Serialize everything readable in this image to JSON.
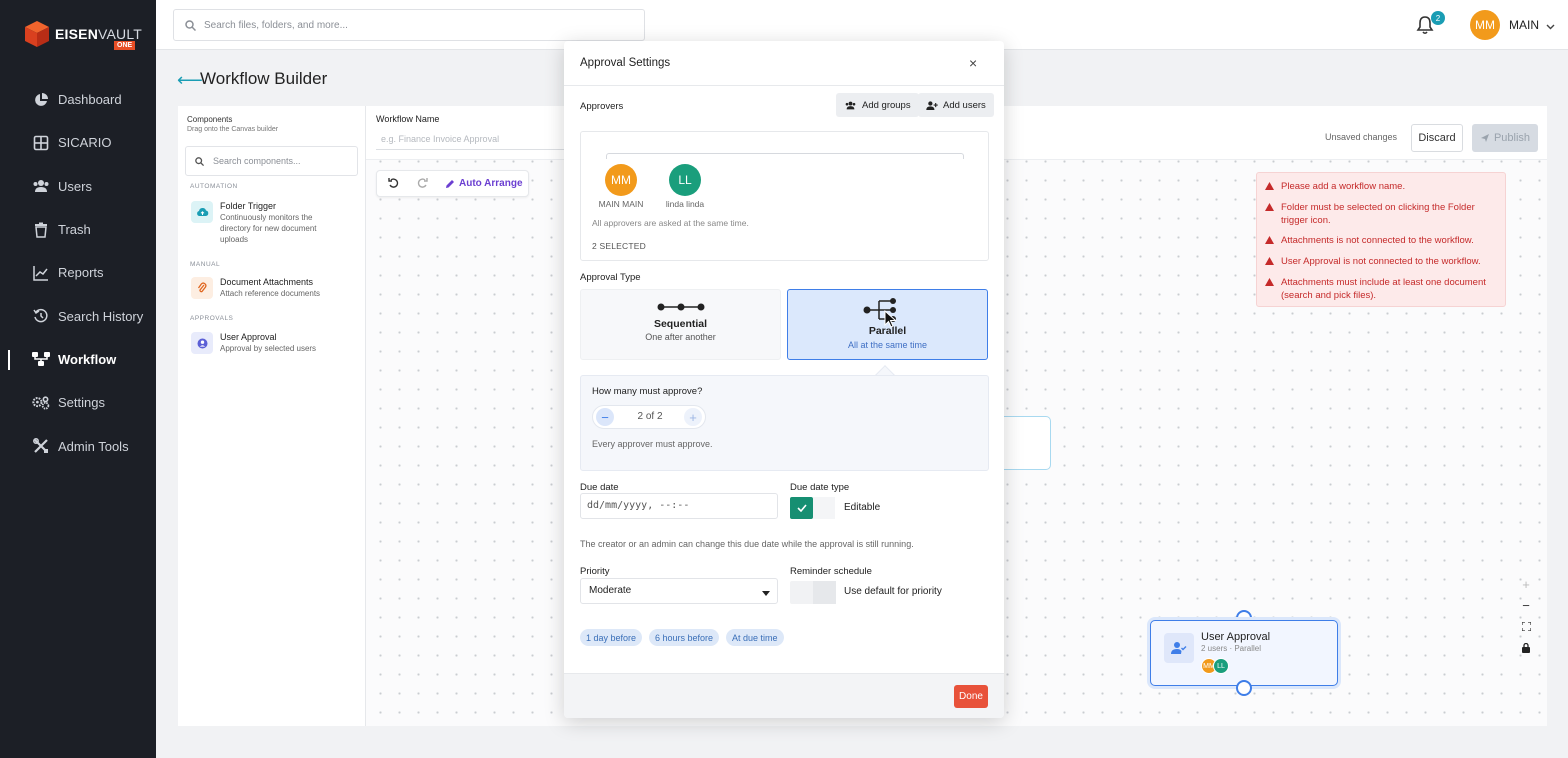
{
  "brand": {
    "name_bold": "EISEN",
    "name_light": "VAULT",
    "badge": "ONE"
  },
  "colors": {
    "accent": "#1a9db4",
    "primary": "#3f7ee8",
    "danger": "#e8523a",
    "success": "#168f72",
    "sidebar_bg": "#1c1f26"
  },
  "sidebar": {
    "items": [
      {
        "label": "Dashboard",
        "icon": "pie-chart-icon"
      },
      {
        "label": "SICARIO",
        "icon": "grid-icon"
      },
      {
        "label": "Users",
        "icon": "users-icon"
      },
      {
        "label": "Trash",
        "icon": "trash-icon"
      },
      {
        "label": "Reports",
        "icon": "line-chart-icon"
      },
      {
        "label": "Search History",
        "icon": "history-icon"
      },
      {
        "label": "Workflow",
        "icon": "workflow-icon",
        "active": true
      },
      {
        "label": "Settings",
        "icon": "gears-icon"
      },
      {
        "label": "Admin Tools",
        "icon": "tools-icon"
      }
    ]
  },
  "topbar": {
    "search_placeholder": "Search files, folders, and more...",
    "notification_count": "2",
    "user_initials": "MM",
    "user_name": "MAIN"
  },
  "page": {
    "title": "Workflow Builder"
  },
  "components_panel": {
    "title": "Components",
    "subtitle": "Drag onto the Canvas builder",
    "search_placeholder": "Search components...",
    "sections": [
      {
        "title": "AUTOMATION",
        "items": [
          {
            "title": "Folder Trigger",
            "desc": "Continuously monitors the directory for new document uploads",
            "icon": "cloud-upload-icon"
          }
        ]
      },
      {
        "title": "MANUAL",
        "items": [
          {
            "title": "Document Attachments",
            "desc": "Attach reference documents",
            "icon": "paperclip-icon"
          }
        ]
      },
      {
        "title": "APPROVALS",
        "items": [
          {
            "title": "User Approval",
            "desc": "Approval by selected users",
            "icon": "user-circle-icon"
          }
        ]
      }
    ]
  },
  "workflow_header": {
    "name_label": "Workflow Name",
    "name_placeholder": "e.g. Finance Invoice Approval",
    "status": "Unsaved changes",
    "discard_label": "Discard",
    "publish_label": "Publish"
  },
  "canvas_toolbar": {
    "auto_arrange_label": "Auto Arrange"
  },
  "errors": [
    "Please add a workflow name.",
    "Folder must be selected on clicking the Folder trigger icon.",
    "Attachments is not connected to the workflow.",
    "User Approval is not connected to the workflow.",
    "Attachments must include at least one document (search and pick files)."
  ],
  "node": {
    "title": "User Approval",
    "subtitle": "2 users · Parallel",
    "avatars": [
      "MM",
      "LL"
    ]
  },
  "modal": {
    "title": "Approval Settings",
    "approvers_label": "Approvers",
    "add_groups_label": "Add groups",
    "add_users_label": "Add users",
    "approvers": [
      {
        "initials": "MM",
        "name": "MAIN MAIN",
        "color": "#f29a1b"
      },
      {
        "initials": "LL",
        "name": "linda linda",
        "color": "#1a9e7c"
      }
    ],
    "approvers_note": "All approvers are asked at the same time.",
    "selected_count": "2 SELECTED",
    "approval_type_label": "Approval Type",
    "types": [
      {
        "title": "Sequential",
        "subtitle": "One after another",
        "selected": false
      },
      {
        "title": "Parallel",
        "subtitle": "All at the same time",
        "selected": true
      }
    ],
    "how_many_label": "How many must approve?",
    "stepper_value": "2 of 2",
    "approve_note": "Every approver must approve.",
    "due_date_label": "Due date",
    "due_date_placeholder": "dd/mm/yyyy, --:--",
    "due_date_type_label": "Due date type",
    "due_date_type_value": "Editable",
    "due_date_note": "The creator or an admin can change this due date while the approval is still running.",
    "priority_label": "Priority",
    "priority_value": "Moderate",
    "reminder_label": "Reminder schedule",
    "reminder_value": "Use default for priority",
    "reminder_chips": [
      "1 day before",
      "6 hours before",
      "At due time"
    ],
    "done_label": "Done"
  }
}
